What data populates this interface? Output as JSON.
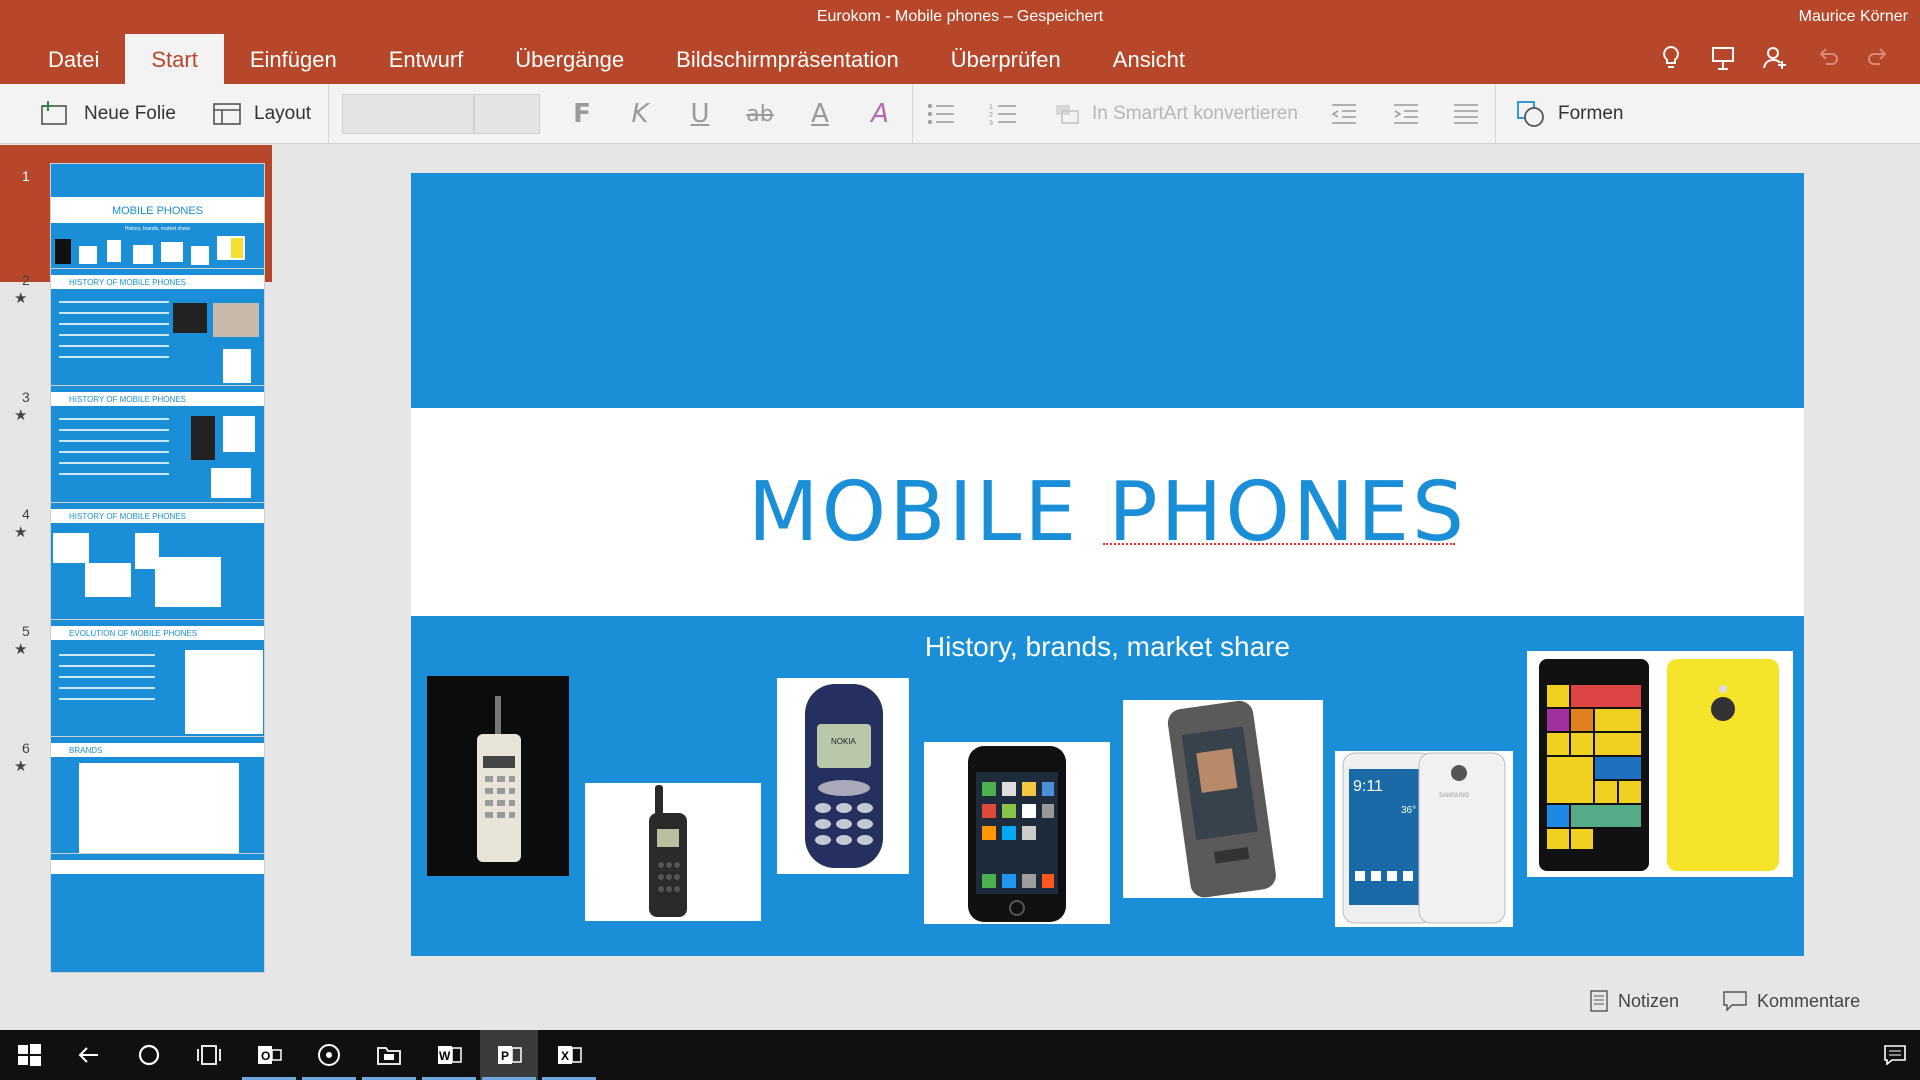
{
  "app": {
    "window_title": "Eurokom - Mobile phones – Gespeichert",
    "user_name": "Maurice Körner",
    "accent": "#b7472a",
    "slide_blue": "#1a8fd8"
  },
  "tabs": [
    {
      "label": "Datei"
    },
    {
      "label": "Start"
    },
    {
      "label": "Einfügen"
    },
    {
      "label": "Entwurf"
    },
    {
      "label": "Übergänge"
    },
    {
      "label": "Bildschirmpräsentation"
    },
    {
      "label": "Überprüfen"
    },
    {
      "label": "Ansicht"
    }
  ],
  "active_tab": "Start",
  "tab_icons": [
    "lightbulb-icon",
    "present-icon",
    "share-user-icon",
    "undo-icon",
    "redo-icon"
  ],
  "ribbon": {
    "new_slide": "Neue Folie",
    "layout": "Layout",
    "bold": "F",
    "italic": "K",
    "underline": "U",
    "strike": "ab",
    "font_color": "A",
    "clear_format": "A",
    "smartart": "In SmartArt konvertieren",
    "shapes": "Formen"
  },
  "thumbnails": [
    {
      "num": "1",
      "title": "MOBILE PHONES",
      "subtitle": "History, brands, market share",
      "star": ""
    },
    {
      "num": "2",
      "title": "HISTORY OF MOBILE PHONES",
      "star": "★"
    },
    {
      "num": "3",
      "title": "HISTORY OF MOBILE PHONES",
      "star": "★"
    },
    {
      "num": "4",
      "title": "HISTORY OF MOBILE PHONES",
      "star": "★"
    },
    {
      "num": "5",
      "title": "EVOLUTION OF MOBILE PHONES",
      "star": "★"
    },
    {
      "num": "6",
      "title": "BRANDS",
      "star": "★"
    }
  ],
  "slide": {
    "title": "MOBILE PHONES",
    "subtitle": "History, brands, market share"
  },
  "bottom": {
    "notes": "Notizen",
    "comments": "Kommentare"
  },
  "taskbar": [
    "windows-start-icon",
    "back-icon",
    "cortana-icon",
    "task-view-icon",
    "outlook-icon",
    "groove-icon",
    "explorer-icon",
    "word-icon",
    "powerpoint-icon",
    "excel-icon",
    "action-center-icon"
  ]
}
